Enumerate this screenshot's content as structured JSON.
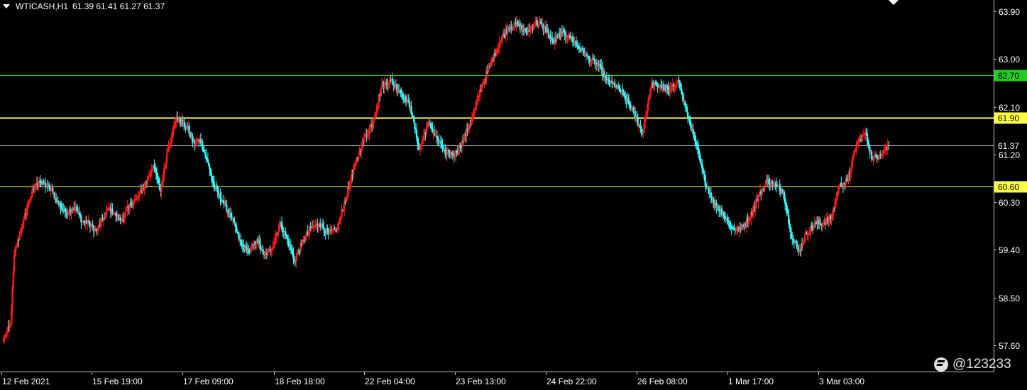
{
  "header": {
    "symbol": "WTICASH,H1",
    "ohlc": "61.39 61.41 61.27 61.37"
  },
  "watermark": {
    "text": "@123233"
  },
  "colors": {
    "background": "#000000",
    "bull": "#ff1a1a",
    "bear": "#33ffff",
    "axis": "#c0c0c0",
    "text": "#ffffff"
  },
  "chart_data": {
    "type": "candlestick",
    "title": "WTICASH,H1",
    "y_axis": {
      "position": "right",
      "ticks": [
        57.6,
        58.5,
        59.4,
        60.3,
        61.2,
        62.1,
        63.0,
        63.9
      ],
      "tick_labels": [
        "57.60",
        "58.50",
        "59.40",
        "60.30",
        "61.20",
        "62.10",
        "63.00",
        "63.90"
      ],
      "range": [
        57.3,
        64.05
      ]
    },
    "x_axis": {
      "tick_labels": [
        "12 Feb 2021",
        "15 Feb 19:00",
        "17 Feb 09:00",
        "18 Feb 18:00",
        "22 Feb 04:00",
        "23 Feb 13:00",
        "24 Feb 22:00",
        "26 Feb 08:00",
        "1 Mar 17:00",
        "3 Mar 03:00"
      ]
    },
    "horizontal_lines": [
      {
        "price": 62.7,
        "label": "62.70",
        "color": "#22cc22",
        "label_bg": "#22cc22",
        "label_fg": "#000000"
      },
      {
        "price": 61.9,
        "label": "61.90",
        "color": "#ffff44",
        "label_bg": "#ffff44",
        "label_fg": "#000000"
      },
      {
        "price": 61.37,
        "label": "61.37",
        "color": "#c0c0c0",
        "label_bg": "#000000",
        "label_fg": "#ffffff"
      },
      {
        "price": 60.6,
        "label": "60.60",
        "color": "#ffff44",
        "label_bg": "#ffff44",
        "label_fg": "#000000"
      }
    ],
    "grid": false,
    "anchors": [
      [
        0,
        57.72
      ],
      [
        3,
        57.8
      ],
      [
        8,
        58.0
      ],
      [
        12,
        59.3
      ],
      [
        20,
        59.8
      ],
      [
        28,
        60.3
      ],
      [
        34,
        60.55
      ],
      [
        40,
        60.7
      ],
      [
        48,
        60.6
      ],
      [
        55,
        60.5
      ],
      [
        60,
        60.3
      ],
      [
        70,
        60.1
      ],
      [
        80,
        60.2
      ],
      [
        88,
        59.95
      ],
      [
        96,
        59.9
      ],
      [
        104,
        59.75
      ],
      [
        112,
        60.0
      ],
      [
        118,
        60.2
      ],
      [
        126,
        60.05
      ],
      [
        132,
        59.95
      ],
      [
        140,
        60.2
      ],
      [
        150,
        60.4
      ],
      [
        158,
        60.6
      ],
      [
        168,
        61.0
      ],
      [
        176,
        60.5
      ],
      [
        184,
        61.3
      ],
      [
        194,
        61.9
      ],
      [
        206,
        61.7
      ],
      [
        214,
        61.4
      ],
      [
        220,
        61.5
      ],
      [
        228,
        61.1
      ],
      [
        236,
        60.6
      ],
      [
        246,
        60.3
      ],
      [
        256,
        60.0
      ],
      [
        266,
        59.5
      ],
      [
        276,
        59.35
      ],
      [
        284,
        59.6
      ],
      [
        292,
        59.3
      ],
      [
        300,
        59.4
      ],
      [
        310,
        59.9
      ],
      [
        318,
        59.6
      ],
      [
        326,
        59.2
      ],
      [
        334,
        59.5
      ],
      [
        344,
        59.8
      ],
      [
        354,
        59.9
      ],
      [
        364,
        59.7
      ],
      [
        374,
        59.8
      ],
      [
        384,
        60.4
      ],
      [
        394,
        61.0
      ],
      [
        404,
        61.5
      ],
      [
        414,
        61.8
      ],
      [
        424,
        62.5
      ],
      [
        434,
        62.6
      ],
      [
        444,
        62.4
      ],
      [
        456,
        62.1
      ],
      [
        466,
        61.3
      ],
      [
        476,
        61.8
      ],
      [
        486,
        61.5
      ],
      [
        496,
        61.2
      ],
      [
        506,
        61.2
      ],
      [
        516,
        61.5
      ],
      [
        526,
        61.9
      ],
      [
        536,
        62.5
      ],
      [
        546,
        62.9
      ],
      [
        556,
        63.3
      ],
      [
        566,
        63.6
      ],
      [
        576,
        63.65
      ],
      [
        586,
        63.5
      ],
      [
        596,
        63.7
      ],
      [
        606,
        63.6
      ],
      [
        616,
        63.3
      ],
      [
        626,
        63.5
      ],
      [
        636,
        63.4
      ],
      [
        646,
        63.2
      ],
      [
        656,
        63.0
      ],
      [
        666,
        62.9
      ],
      [
        676,
        62.6
      ],
      [
        686,
        62.5
      ],
      [
        696,
        62.3
      ],
      [
        706,
        62.0
      ],
      [
        716,
        61.6
      ],
      [
        726,
        62.5
      ],
      [
        736,
        62.5
      ],
      [
        746,
        62.4
      ],
      [
        756,
        62.6
      ],
      [
        766,
        62.0
      ],
      [
        776,
        61.4
      ],
      [
        786,
        60.7
      ],
      [
        796,
        60.3
      ],
      [
        806,
        60.1
      ],
      [
        816,
        59.8
      ],
      [
        826,
        59.8
      ],
      [
        836,
        60.0
      ],
      [
        846,
        60.4
      ],
      [
        856,
        60.7
      ],
      [
        866,
        60.6
      ],
      [
        874,
        60.5
      ],
      [
        884,
        59.6
      ],
      [
        892,
        59.4
      ],
      [
        900,
        59.7
      ],
      [
        910,
        59.9
      ],
      [
        918,
        59.9
      ],
      [
        928,
        60.0
      ],
      [
        936,
        60.6
      ],
      [
        946,
        60.7
      ],
      [
        956,
        61.4
      ],
      [
        966,
        61.6
      ],
      [
        974,
        61.1
      ],
      [
        982,
        61.2
      ],
      [
        992,
        61.37
      ]
    ]
  }
}
